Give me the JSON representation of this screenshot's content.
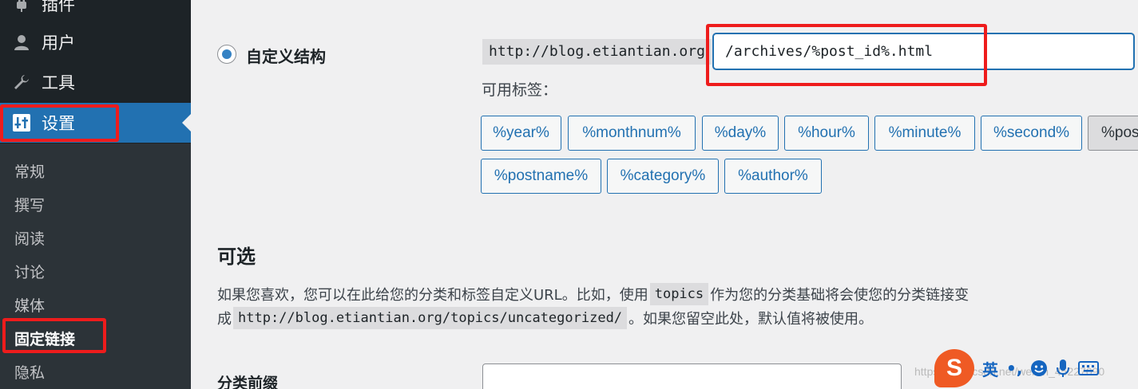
{
  "sidebar": {
    "menu": [
      {
        "label": "插件",
        "icon": "plugin-icon"
      },
      {
        "label": "用户",
        "icon": "user-icon"
      },
      {
        "label": "工具",
        "icon": "wrench-icon"
      },
      {
        "label": "设置",
        "icon": "settings-sliders-icon",
        "active": true
      }
    ],
    "submenu": [
      "常规",
      "撰写",
      "阅读",
      "讨论",
      "媒体",
      "固定链接",
      "隐私"
    ],
    "current_submenu": "固定链接"
  },
  "permalink": {
    "custom_label": "自定义结构",
    "selected": true,
    "prefix": "http://blog.etiantian.org",
    "structure_value": "/archives/%post_id%.html",
    "available_tags_label": "可用标签：",
    "tags": [
      "%year%",
      "%monthnum%",
      "%day%",
      "%hour%",
      "%minute%",
      "%second%",
      "%pos",
      "%postname%",
      "%category%",
      "%author%"
    ]
  },
  "optional": {
    "title": "可选",
    "desc_line1_a": "如果您喜欢，您可以在此给您的分类和标签自定义URL。比如，使用",
    "desc_code1": "topics",
    "desc_line1_b": "作为您的分类基础将会使您的分类链接变",
    "desc_line2_a": "成",
    "desc_code2": "http://blog.etiantian.org/topics/uncategorized/",
    "desc_line2_b": "。如果您留空此处，默认值将被使用。",
    "category_base_label": "分类前缀",
    "category_base_value": ""
  },
  "ime": {
    "logo": "S",
    "lang": "英",
    "punct": "•,",
    "icons": [
      "emoji-icon",
      "microphone-icon",
      "keyboard-icon"
    ]
  },
  "watermark": "https://blog.csdn.net/weixin_45227090",
  "colors": {
    "accent": "#2271b1",
    "highlight_box": "#ee1c1c",
    "sidebar_bg": "#1d2327",
    "ime_brand": "#ef5a24"
  }
}
